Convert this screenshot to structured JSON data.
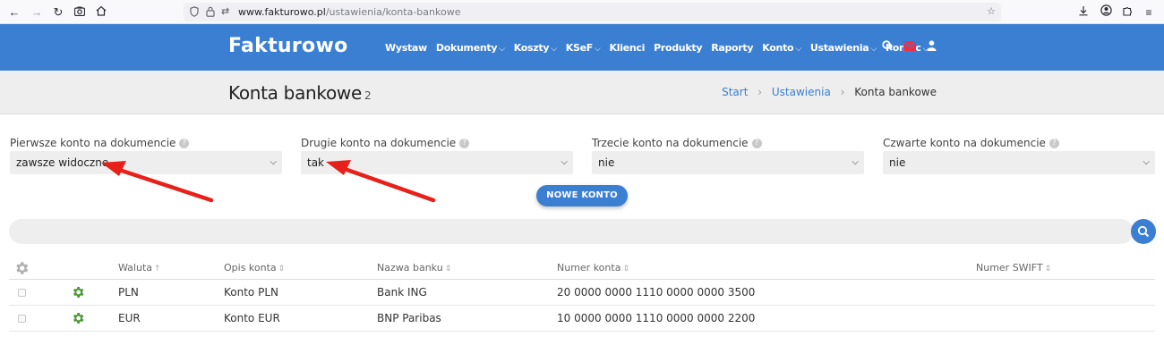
{
  "browser": {
    "url_domain": "www.fakturowo.pl",
    "url_path": "/ustawienia/konta-bankowe"
  },
  "navbar": {
    "logo": "Fakturowo",
    "menu": [
      {
        "label": "Wystaw",
        "dropdown": false
      },
      {
        "label": "Dokumenty",
        "dropdown": true
      },
      {
        "label": "Koszty",
        "dropdown": true
      },
      {
        "label": "KSeF",
        "dropdown": true
      },
      {
        "label": "Klienci",
        "dropdown": false
      },
      {
        "label": "Produkty",
        "dropdown": false
      },
      {
        "label": "Raporty",
        "dropdown": false
      },
      {
        "label": "Konto",
        "dropdown": true
      },
      {
        "label": "Ustawienia",
        "dropdown": true
      },
      {
        "label": "Pomoc",
        "dropdown": true
      }
    ]
  },
  "page": {
    "title": "Konta bankowe",
    "count": "2"
  },
  "breadcrumb": {
    "start": "Start",
    "settings": "Ustawienia",
    "current": "Konta bankowe"
  },
  "fields": [
    {
      "label": "Pierwsze konto na dokumencie",
      "value": "zawsze widoczne"
    },
    {
      "label": "Drugie konto na dokumencie",
      "value": "tak"
    },
    {
      "label": "Trzecie konto na dokumencie",
      "value": "nie"
    },
    {
      "label": "Czwarte konto na dokumencie",
      "value": "nie"
    }
  ],
  "new_account_button": "NOWE KONTO",
  "table": {
    "headers": {
      "currency": "Waluta",
      "description": "Opis konta",
      "bank": "Nazwa banku",
      "number": "Numer konta",
      "swift": "Numer SWIFT"
    },
    "rows": [
      {
        "currency": "PLN",
        "description": "Konto PLN",
        "bank": "Bank ING",
        "number": "20 0000 0000 1110 0000 0000 3500",
        "swift": ""
      },
      {
        "currency": "EUR",
        "description": "Konto EUR",
        "bank": "BNP Paribas",
        "number": "10 0000 0000 1110 0000 0000 2200",
        "swift": ""
      }
    ]
  },
  "colors": {
    "brand": "#3b7fd2",
    "gear_green": "#4e9a3a",
    "annotation_red": "#e8201a"
  }
}
